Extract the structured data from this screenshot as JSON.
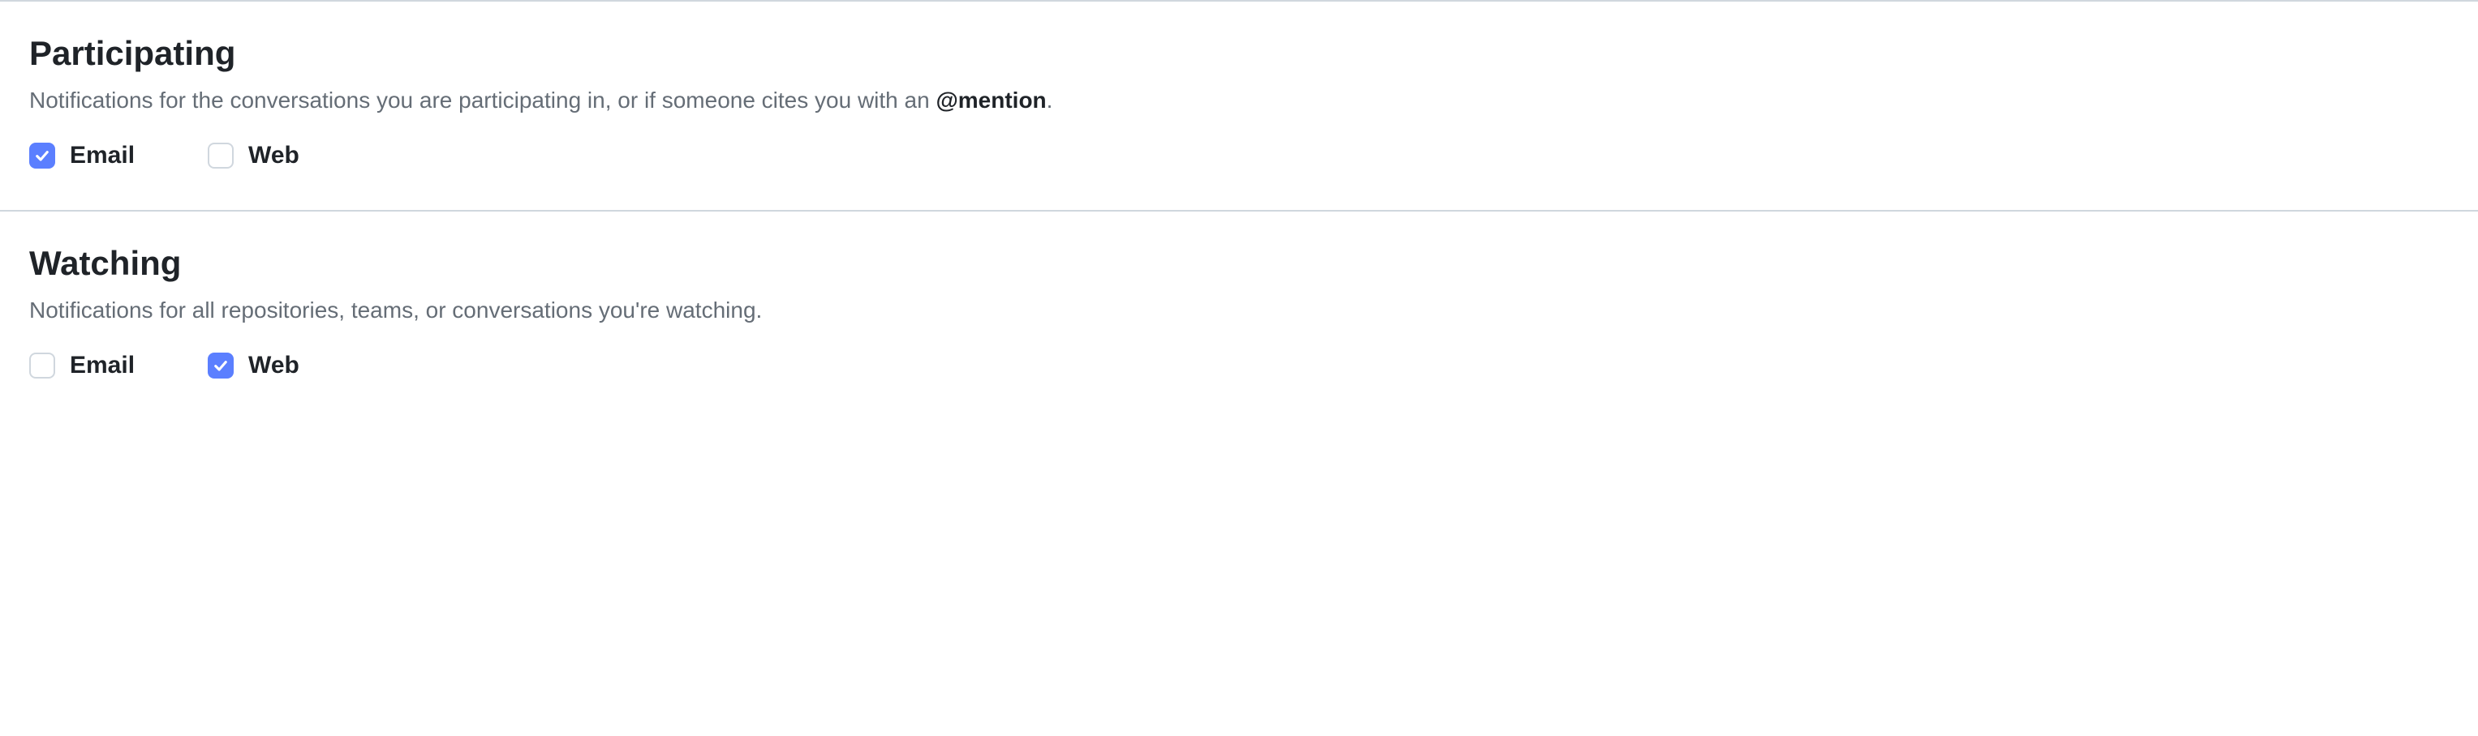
{
  "sections": [
    {
      "title": "Participating",
      "description_pre": "Notifications for the conversations you are participating in, or if someone cites you with an ",
      "description_bold": "@mention",
      "description_post": ".",
      "options": [
        {
          "label": "Email",
          "checked": true
        },
        {
          "label": "Web",
          "checked": false
        }
      ]
    },
    {
      "title": "Watching",
      "description_pre": "Notifications for all repositories, teams, or conversations you're watching.",
      "description_bold": "",
      "description_post": "",
      "options": [
        {
          "label": "Email",
          "checked": false
        },
        {
          "label": "Web",
          "checked": true
        }
      ]
    }
  ]
}
